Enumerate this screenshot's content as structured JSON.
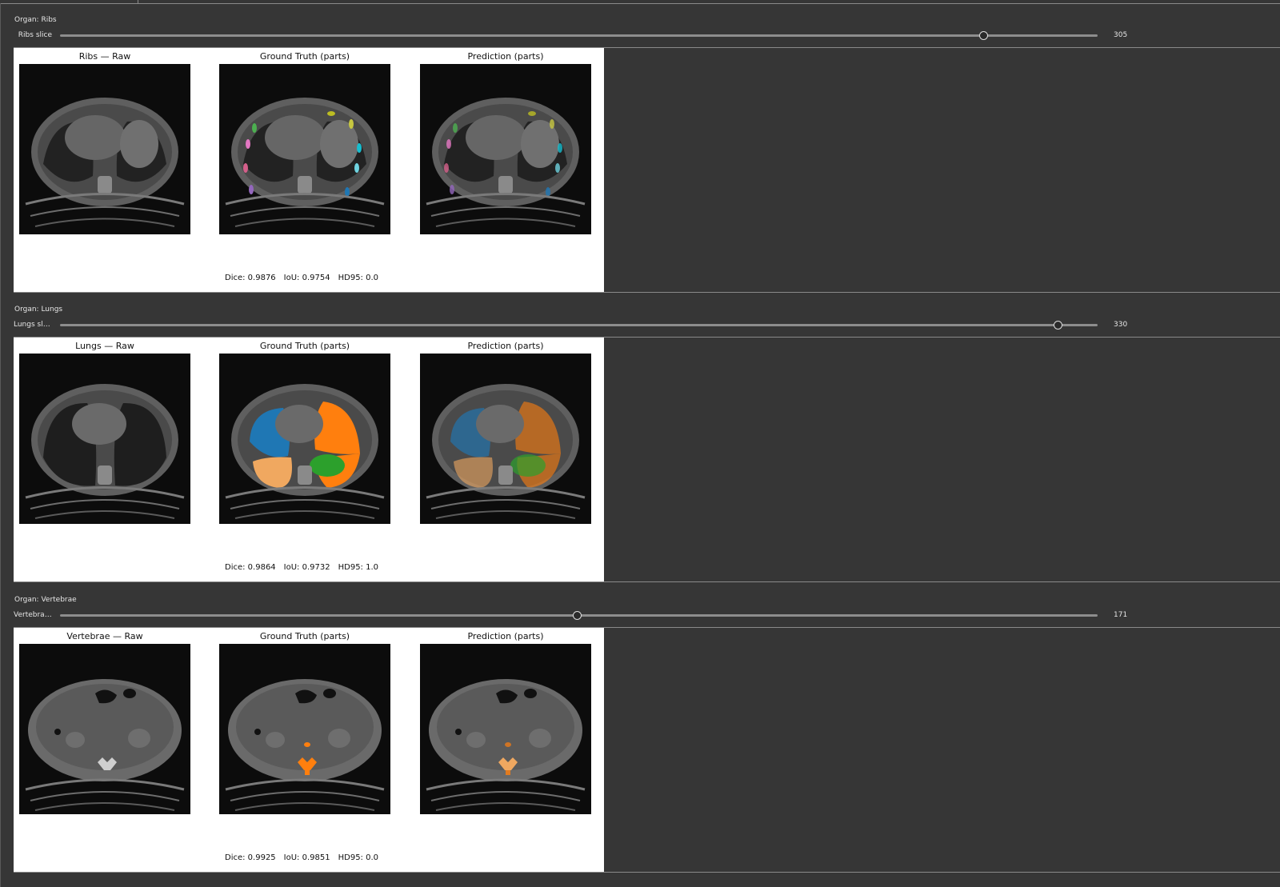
{
  "sections": [
    {
      "organ_label": "Organ: Ribs",
      "slider_label": "Ribs slice",
      "slider_value": "305",
      "slider_fraction": 0.889,
      "titles": [
        "Ribs — Raw",
        "Ground Truth (parts)",
        "Prediction (parts)"
      ],
      "metrics": {
        "dice": "Dice: 0.9876",
        "iou": "IoU: 0.9754",
        "hd95": "HD95: 0.0"
      }
    },
    {
      "organ_label": "Organ: Lungs",
      "slider_label": "Lungs slice",
      "slider_value": "330",
      "slider_fraction": 0.961,
      "titles": [
        "Lungs — Raw",
        "Ground Truth (parts)",
        "Prediction (parts)"
      ],
      "metrics": {
        "dice": "Dice: 0.9864",
        "iou": "IoU: 0.9732",
        "hd95": "HD95: 1.0"
      }
    },
    {
      "organ_label": "Organ: Vertebrae",
      "slider_label": "Vertebrae ...",
      "slider_value": "171",
      "slider_fraction": 0.498,
      "titles": [
        "Vertebrae — Raw",
        "Ground Truth (parts)",
        "Prediction (parts)"
      ],
      "metrics": {
        "dice": "Dice: 0.9925",
        "iou": "IoU: 0.9851",
        "hd95": "HD95: 0.0"
      }
    }
  ],
  "colors": {
    "background": "#363636",
    "figure_bg": "#ffffff",
    "scan_bg": "#0c0c0c",
    "lung_blue": "#1f77b4",
    "lung_orange": "#ff7f0e",
    "lung_peach": "#f0a860",
    "lung_green": "#2ca02c"
  }
}
